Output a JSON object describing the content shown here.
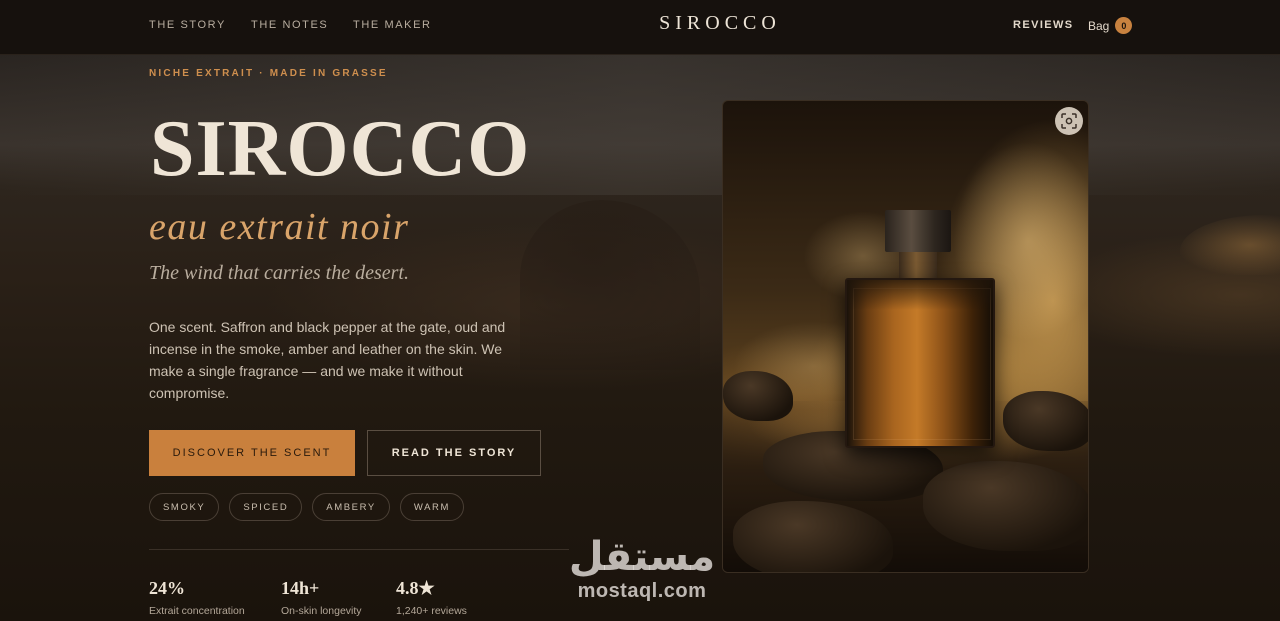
{
  "nav": {
    "links": [
      {
        "label": "THE STORY"
      },
      {
        "label": "THE NOTES"
      },
      {
        "label": "THE MAKER"
      }
    ],
    "brand": "SIROCCO",
    "reviews": "REVIEWS",
    "bag_label": "Bag",
    "bag_count": "0"
  },
  "hero": {
    "eyebrow": "NICHE EXTRAIT · MADE IN GRASSE",
    "title": "SIROCCO",
    "subtitle": "eau extrait noir",
    "tagline": "The wind that carries the desert.",
    "description": "One scent. Saffron and black pepper at the gate, oud and incense in the smoke, amber and leather on the skin. We make a single fragrance — and we make it without compromise.",
    "primary_cta": "DISCOVER THE SCENT",
    "secondary_cta": "READ THE STORY",
    "tags": [
      "SMOKY",
      "SPICED",
      "AMBERY",
      "WARM"
    ],
    "stats": [
      {
        "value": "24%",
        "label": "Extrait concentration"
      },
      {
        "value": "14h+",
        "label": "On-skin longevity"
      },
      {
        "value": "4.8★",
        "label": "1,240+ reviews"
      }
    ]
  },
  "product_image": {
    "icon": "focus-icon"
  },
  "watermark": {
    "arabic": "مستقل",
    "latin": "mostaql.com"
  },
  "colors": {
    "accent": "#c9803d",
    "background": "#1e1711",
    "nav_background": "#16110d",
    "subtitle": "#d9a46a"
  }
}
